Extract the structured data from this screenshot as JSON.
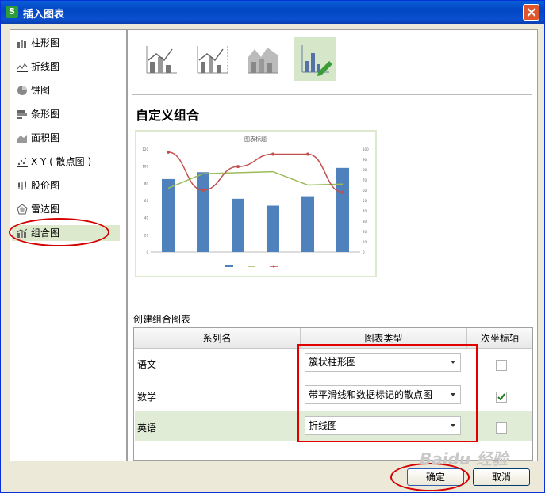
{
  "window": {
    "title": "插入图表",
    "app_icon": "S"
  },
  "nav": {
    "items": [
      {
        "label": "柱形图",
        "icon": "column-chart-icon"
      },
      {
        "label": "折线图",
        "icon": "line-chart-icon"
      },
      {
        "label": "饼图",
        "icon": "pie-chart-icon"
      },
      {
        "label": "条形图",
        "icon": "bar-chart-icon"
      },
      {
        "label": "面积图",
        "icon": "area-chart-icon"
      },
      {
        "label": "X Y ( 散点图 )",
        "icon": "scatter-chart-icon"
      },
      {
        "label": "股价图",
        "icon": "stock-chart-icon"
      },
      {
        "label": "雷达图",
        "icon": "radar-chart-icon"
      },
      {
        "label": "组合图",
        "icon": "combo-chart-icon"
      }
    ],
    "selected": "组合图"
  },
  "combo_title": "自定义组合",
  "preview": {
    "title": "图表标题",
    "y_left_ticks": [
      "0",
      "20",
      "40",
      "60",
      "80",
      "100",
      "120"
    ],
    "y_right_ticks": [
      "0",
      "10",
      "20",
      "30",
      "40",
      "50",
      "60",
      "70",
      "80",
      "90",
      "100"
    ]
  },
  "chart_data": {
    "type": "bar",
    "title": "图表标题",
    "categories": [
      "",
      "",
      "",
      "",
      "",
      ""
    ],
    "ylim": [
      0,
      120
    ],
    "y2lim": [
      0,
      100
    ],
    "series": [
      {
        "kind": "bar",
        "values": [
          85,
          93,
          62,
          54,
          65,
          98
        ]
      },
      {
        "kind": "line",
        "values": [
          62,
          76,
          77,
          78,
          65,
          66
        ]
      },
      {
        "kind": "line",
        "values": [
          97,
          60,
          83,
          95,
          95,
          58
        ]
      }
    ],
    "colors": [
      "#4f81bd",
      "#9bbb59",
      "#c0504d"
    ]
  },
  "table": {
    "section_label": "创建组合图表",
    "headers": [
      "系列名",
      "图表类型",
      "次坐标轴"
    ],
    "rows": [
      {
        "name": "语文",
        "type": "簇状柱形图",
        "secondary_axis": false
      },
      {
        "name": "数学",
        "type": "带平滑线和数据标记的散点图",
        "secondary_axis": true
      },
      {
        "name": "英语",
        "type": "折线图",
        "secondary_axis": false
      }
    ]
  },
  "buttons": {
    "ok": "确定",
    "cancel": "取消"
  },
  "watermark": "Baidu 经验"
}
